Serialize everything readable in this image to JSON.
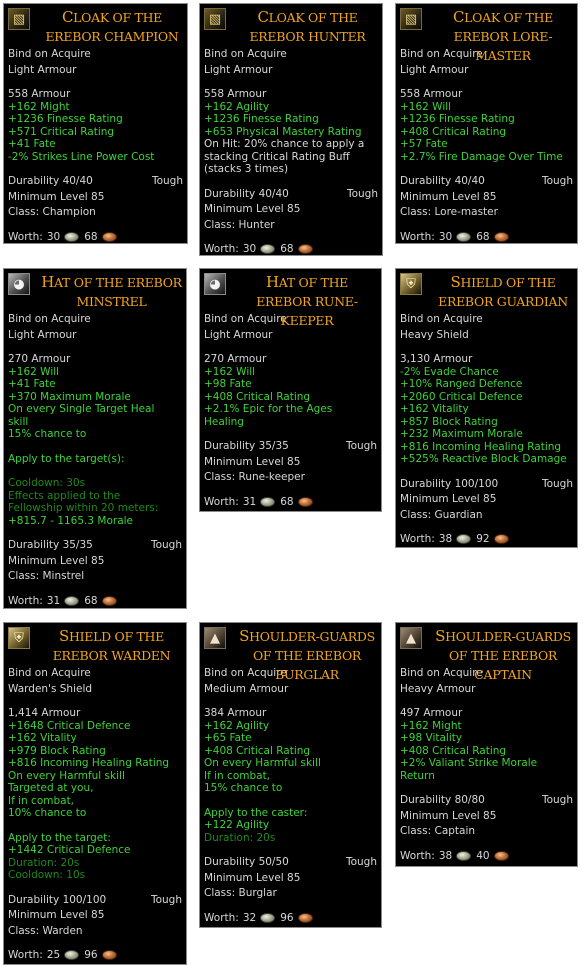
{
  "cards": [
    {
      "name": "Cloak of the Erebor Champion",
      "icon": "cloak-icon",
      "bind": "Bind on Acquire",
      "type": "Light Armour",
      "armour": "558 Armour",
      "effects": [
        "+162 Might",
        "+1236 Finesse Rating",
        "+571 Critical Rating",
        "+41 Fate",
        "-2% Strikes Line Power Cost"
      ],
      "durability": "Durability 40/40",
      "quality": "Tough",
      "min_level": "Minimum Level 85",
      "class": "Class: Champion",
      "worth_label": "Worth:",
      "silver": "30",
      "copper": "68"
    },
    {
      "name": "Cloak of the Erebor Hunter",
      "icon": "cloak-icon",
      "bind": "Bind on Acquire",
      "type": "Light Armour",
      "armour": "558 Armour",
      "effects": [
        "+162 Agility",
        "+1236 Finesse Rating",
        "+653 Physical Mastery Rating"
      ],
      "onhit": [
        "On Hit: 20% chance to apply a",
        "stacking Critical Rating Buff",
        "(stacks 3 times)"
      ],
      "durability": "Durability 40/40",
      "quality": "Tough",
      "min_level": "Minimum Level 85",
      "class": "Class: Hunter",
      "worth_label": "Worth:",
      "silver": "30",
      "copper": "68"
    },
    {
      "name": "Cloak of the Erebor Lore-master",
      "icon": "cloak-icon",
      "bind": "Bind on Acquire",
      "type": "Light Armour",
      "armour": "558 Armour",
      "effects": [
        "+162 Will",
        "+1236 Finesse Rating",
        "+408 Critical Rating",
        "+57 Fate",
        "+2.7% Fire Damage Over Time"
      ],
      "durability": "Durability 40/40",
      "quality": "Tough",
      "min_level": "Minimum Level 85",
      "class": "Class: Lore-master",
      "worth_label": "Worth:",
      "silver": "30",
      "copper": "68"
    },
    {
      "name": "Hat of the Erebor Minstrel",
      "icon": "helm-icon",
      "bind": "Bind on Acquire",
      "type": "Light Armour",
      "armour": "270 Armour",
      "effects": [
        "+162 Will",
        "+41 Fate",
        "+370 Maximum Morale",
        "On every Single Target Heal",
        "skill",
        "15% chance to"
      ],
      "apply": "Apply to the target(s):",
      "dim": [
        "Cooldown: 30s",
        "Effects applied to the",
        "Fellowship within 20 meters:"
      ],
      "extra": "+815.7 - 1165.3 Morale",
      "durability": "Durability 35/35",
      "quality": "Tough",
      "min_level": "Minimum Level 85",
      "class": "Class: Minstrel",
      "worth_label": "Worth:",
      "silver": "31",
      "copper": "68"
    },
    {
      "name": "Hat of the Erebor Rune-keeper",
      "icon": "helm-icon",
      "bind": "Bind on Acquire",
      "type": "Light Armour",
      "armour": "270 Armour",
      "effects": [
        "+162 Will",
        "+98 Fate",
        "+408 Critical Rating",
        "+2.1% Epic for the Ages",
        "Healing"
      ],
      "durability": "Durability 35/35",
      "quality": "Tough",
      "min_level": "Minimum Level 85",
      "class": "Class: Rune-keeper",
      "worth_label": "Worth:",
      "silver": "31",
      "copper": "68"
    },
    {
      "name": "Shield of the Erebor Guardian",
      "icon": "shield-icon",
      "bind": "Bind on Acquire",
      "type": "Heavy Shield",
      "armour": "3,130 Armour",
      "effects": [
        "-2% Evade Chance",
        "+10% Ranged Defence",
        "+2060 Critical Defence",
        "+162 Vitality",
        "+857 Block Rating",
        "+232 Maximum Morale",
        "+816 Incoming Healing Rating",
        "+525% Reactive Block Damage"
      ],
      "durability": "Durability 100/100",
      "quality": "Tough",
      "min_level": "Minimum Level 85",
      "class": "Class: Guardian",
      "worth_label": "Worth:",
      "silver": "38",
      "copper": "92"
    },
    {
      "name": "Shield of the Erebor Warden",
      "icon": "shield-icon",
      "bind": "Bind on Acquire",
      "type": "Warden's Shield",
      "armour": "1,414 Armour",
      "effects": [
        "+1648 Critical Defence",
        "+162 Vitality",
        "+979 Block Rating",
        "+816 Incoming Healing Rating",
        "On every Harmful skill",
        "Targeted at you,",
        "If in combat,",
        "10% chance to"
      ],
      "apply": "Apply to the target:",
      "extra": "+1442 Critical Defence",
      "dim": [
        "Duration: 20s",
        "Cooldown: 10s"
      ],
      "durability": "Durability 100/100",
      "quality": "Tough",
      "min_level": "Minimum Level 85",
      "class": "Class: Warden",
      "worth_label": "Worth:",
      "silver": "25",
      "copper": "96"
    },
    {
      "name": "Shoulder-guards of the Erebor Burglar",
      "icon": "shoulder-icon",
      "bind": "Bind on Acquire",
      "type": "Medium Armour",
      "armour": "384 Armour",
      "effects": [
        "+162 Agility",
        "+65 Fate",
        "+408 Critical Rating",
        "On every Harmful skill",
        "If in combat,",
        "15% chance to"
      ],
      "apply": "Apply to the caster:",
      "extra": "+122 Agility",
      "dim": [
        "Duration: 20s"
      ],
      "durability": "Durability 50/50",
      "quality": "Tough",
      "min_level": "Minimum Level 85",
      "class": "Class: Burglar",
      "worth_label": "Worth:",
      "silver": "32",
      "copper": "96"
    },
    {
      "name": "Shoulder-guards of the Erebor Captain",
      "icon": "shoulder-icon",
      "bind": "Bind on Acquire",
      "type": "Heavy Armour",
      "armour": "497 Armour",
      "effects": [
        "+162 Might",
        "+98 Vitality",
        "+408 Critical Rating",
        "+2% Valiant Strike Morale",
        "Return"
      ],
      "durability": "Durability 80/80",
      "quality": "Tough",
      "min_level": "Minimum Level 85",
      "class": "Class: Captain",
      "worth_label": "Worth:",
      "silver": "38",
      "copper": "40"
    }
  ],
  "colors": {
    "item_name": "#f2a41e",
    "effect_green": "#3fd23a",
    "dim_green": "#1f8a1a",
    "text": "#d8d8d8",
    "background": "#000000"
  }
}
